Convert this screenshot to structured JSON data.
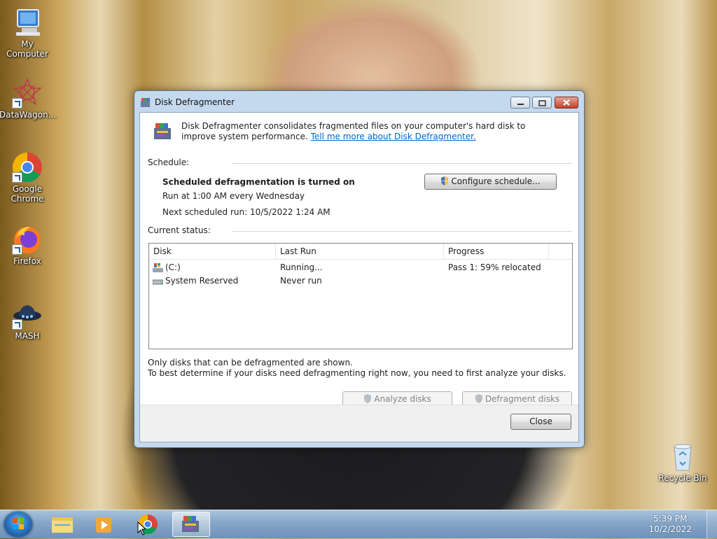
{
  "desktop": {
    "icons": [
      {
        "label": "My Computer"
      },
      {
        "label": "DataWagon..."
      },
      {
        "label": "Google Chrome"
      },
      {
        "label": "Firefox"
      },
      {
        "label": "MASH"
      },
      {
        "label": "Recycle Bin"
      }
    ]
  },
  "window": {
    "title": "Disk Defragmenter",
    "intro_text": "Disk Defragmenter consolidates fragmented files on your computer's hard disk to improve system performance.",
    "intro_link": "Tell me more about Disk Defragmenter.",
    "schedule": {
      "section_label": "Schedule:",
      "status": "Scheduled defragmentation is turned on",
      "run_at": "Run at 1:00 AM every Wednesday",
      "next_run": "Next scheduled run: 10/5/2022 1:24 AM",
      "configure_button": "Configure schedule..."
    },
    "current_status": {
      "section_label": "Current status:",
      "columns": [
        "Disk",
        "Last Run",
        "Progress"
      ],
      "rows": [
        {
          "disk": "(C:)",
          "last_run": "Running...",
          "progress": "Pass 1: 59% relocated",
          "icon": "windows-drive-icon"
        },
        {
          "disk": "System Reserved",
          "last_run": "Never run",
          "progress": "",
          "icon": "drive-icon"
        }
      ]
    },
    "notes": [
      "Only disks that can be defragmented are shown.",
      "To best determine if your disks need defragmenting right now, you need to first analyze your disks."
    ],
    "buttons": {
      "analyze": "Analyze disks",
      "defragment": "Defragment disks",
      "close": "Close"
    }
  },
  "taskbar": {
    "time": "5:39 PM",
    "date": "10/2/2022",
    "items": [
      "windows-explorer",
      "media-player",
      "google-chrome",
      "disk-defragmenter"
    ]
  }
}
